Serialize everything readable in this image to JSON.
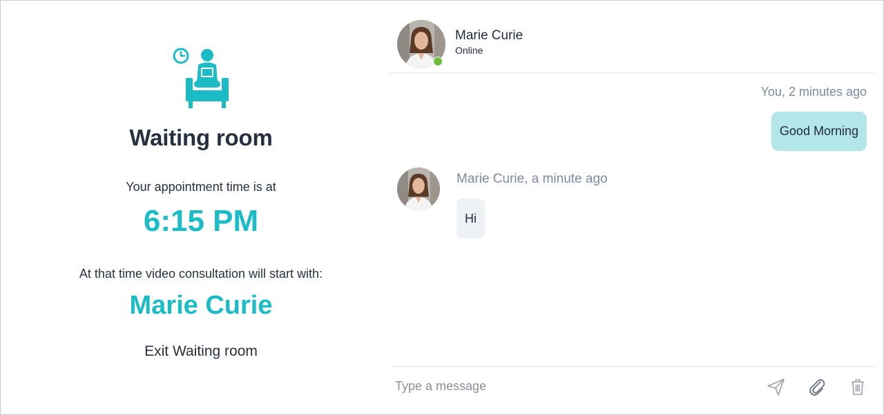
{
  "waiting_room": {
    "icon": "waiting-room-icon",
    "title": "Waiting room",
    "appointment_label": "Your appointment time is at",
    "appointment_time": "6:15 PM",
    "consultation_label": "At that time video consultation will start with:",
    "doctor_name": "Marie Curie",
    "exit_label": "Exit Waiting room",
    "accent_color": "#1bbcc6"
  },
  "chat": {
    "contact": {
      "name": "Marie Curie",
      "status": "Online",
      "status_color": "#6ebd3c"
    },
    "messages": [
      {
        "sender": "You",
        "meta": "You, 2 minutes ago",
        "text": "Good Morning",
        "bubble_color": "#b3e6e8"
      },
      {
        "sender": "Marie Curie",
        "meta": "Marie Curie, a minute ago",
        "text": "Hi",
        "bubble_color": "#eef2f6"
      }
    ],
    "composer": {
      "placeholder": "Type a message",
      "value": "",
      "send_icon": "send-icon",
      "attach_icon": "paperclip-icon",
      "delete_icon": "trash-icon"
    }
  }
}
